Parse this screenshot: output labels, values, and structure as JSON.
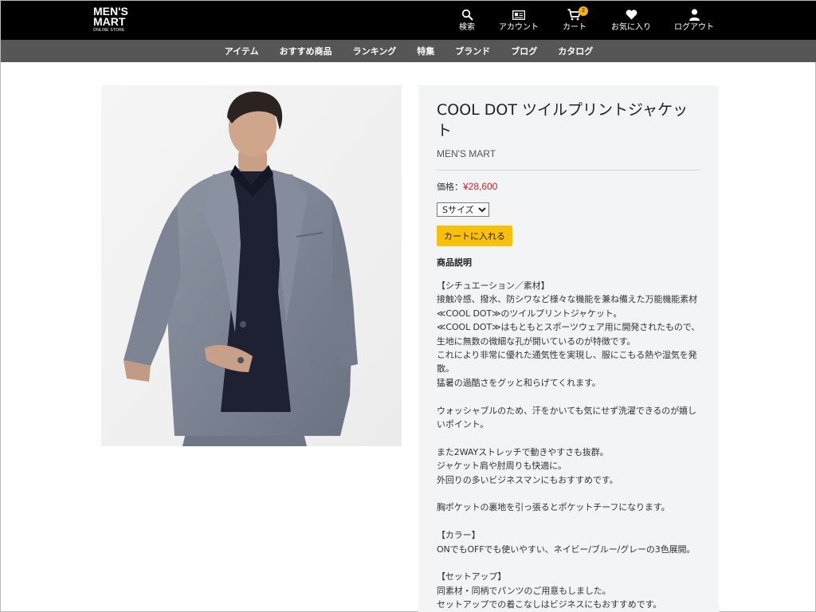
{
  "header": {
    "logo": {
      "line1": "MEN'S",
      "line2": "MART",
      "line3": "ONLINE STORE"
    },
    "nav": [
      {
        "id": "search",
        "label": "検索",
        "icon": "search-icon"
      },
      {
        "id": "account",
        "label": "アカウント",
        "icon": "account-card-icon"
      },
      {
        "id": "cart",
        "label": "カート",
        "icon": "cart-icon",
        "badge": "2"
      },
      {
        "id": "favorites",
        "label": "お気に入り",
        "icon": "heart-icon"
      },
      {
        "id": "logout",
        "label": "ログアウト",
        "icon": "user-icon"
      }
    ]
  },
  "subnav": [
    "アイテム",
    "おすすめ商品",
    "ランキング",
    "特集",
    "ブランド",
    "ブログ",
    "カタログ"
  ],
  "product": {
    "title": "COOL DOT ツイルプリントジャケット",
    "brand": "MEN'S MART",
    "price_label": "価格：",
    "price": "¥28,600",
    "size_selected": "Sサイズ",
    "add_to_cart": "カートに入れる",
    "description_heading": "商品説明",
    "description": [
      "【シチュエーション／素材】",
      "接触冷感、撥水、防シワなど様々な機能を兼ね備えた万能機能素材≪COOL DOT≫のツイルプリントジャケット。",
      "≪COOL DOT≫はもともとスポーツウェア用に開発されたもので、生地に無数の微細な孔が開いているのが特徴です。",
      "これにより非常に優れた通気性を実現し、服にこもる熱や湿気を発散。",
      "猛暑の過酷さをグッと和らげてくれます。",
      "",
      "ウォッシャブルのため、汗をかいても気にせず洗濯できるのが嬉しいポイント。",
      "",
      "また2WAYストレッチで動きやすさも抜群。",
      "ジャケット肩や肘周りも快適に。",
      "外回りの多いビジネスマンにもおすすめです。",
      "",
      "胸ポケットの裏地を引っ張るとポケットチーフになります。",
      "",
      "【カラー】",
      "ONでもOFFでも使いやすい、ネイビー/ブルー/グレーの3色展開。",
      "",
      "【セットアップ】",
      "同素材・同柄でパンツのご用意もしました。",
      "セットアップでの着こなしはビジネスにもおすすめです。"
    ]
  },
  "colors": {
    "header_bg": "#000000",
    "subnav_bg": "#565656",
    "price": "#d0202b",
    "cart_button": "#f8bf0b",
    "panel_bg": "#f3f4f6"
  }
}
